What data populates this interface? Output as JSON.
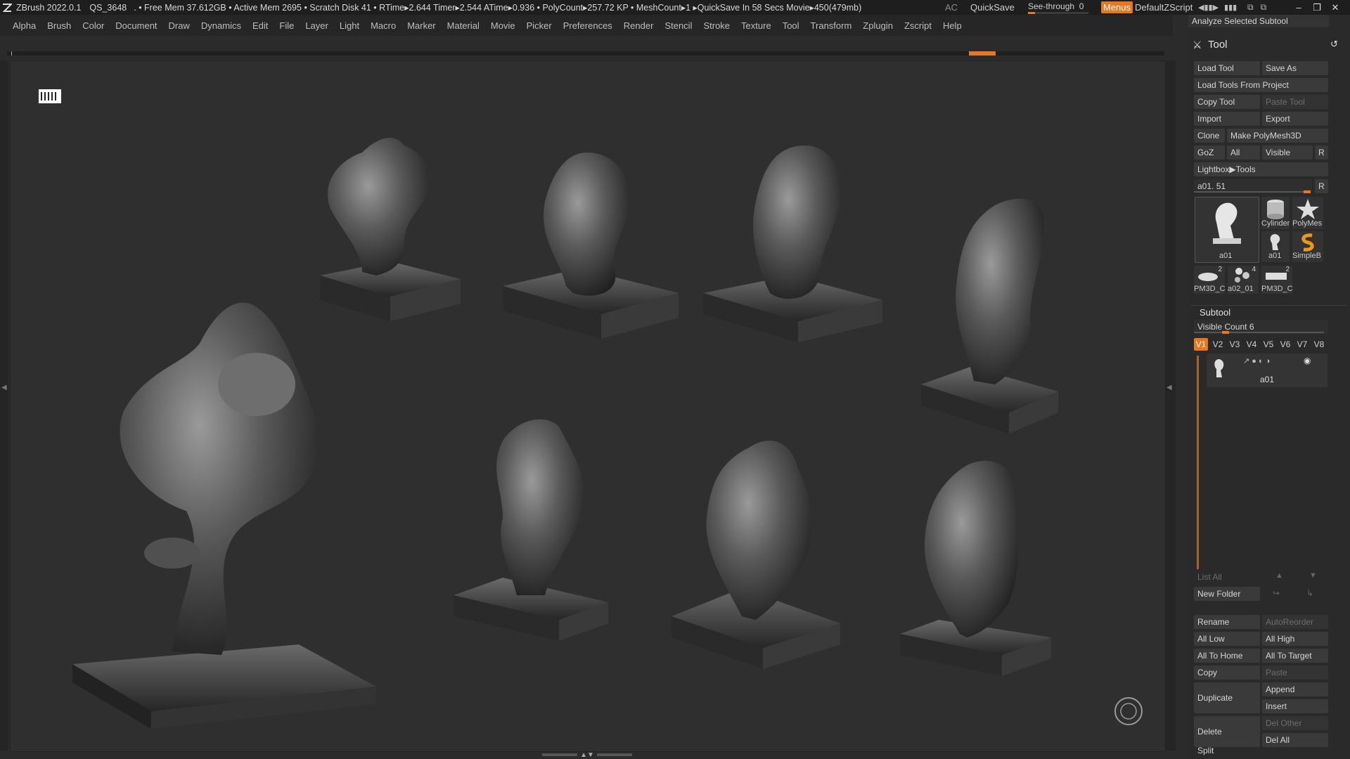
{
  "titlebar": {
    "app": "ZBrush 2022.0.1",
    "project": "QS_3648",
    "status": ". • Free Mem 37.612GB • Active Mem 2695 • Scratch Disk 41 • RTime▸2.644 Timer▸2.544 ATime▸0.936 • PolyCount▸257.72 KP • MeshCount▸1 ▸QuickSave In 58 Secs Movie▸450(479mb)",
    "ac": "AC",
    "quicksave": "QuickSave",
    "see_through_label": "See-through",
    "see_through_value": "0",
    "menus": "Menus",
    "default_zscript": "DefaultZScript"
  },
  "menubar": [
    "Alpha",
    "Brush",
    "Color",
    "Document",
    "Draw",
    "Dynamics",
    "Edit",
    "File",
    "Layer",
    "Light",
    "Macro",
    "Marker",
    "Material",
    "Movie",
    "Picker",
    "Preferences",
    "Render",
    "Stencil",
    "Stroke",
    "Texture",
    "Tool",
    "Transform",
    "Zplugin",
    "Zscript",
    "Help"
  ],
  "tool_panel": {
    "analyze": "Analyze Selected Subtool",
    "title": "Tool",
    "load_tool": "Load Tool",
    "save_as": "Save As",
    "load_tools_from_project": "Load Tools From Project",
    "copy_tool": "Copy Tool",
    "paste_tool": "Paste Tool",
    "import": "Import",
    "export": "Export",
    "clone": "Clone",
    "make_polymesh3d": "Make PolyMesh3D",
    "goz": "GoZ",
    "all": "All",
    "visible": "Visible",
    "r": "R",
    "lightbox_tools": "Lightbox▶Tools",
    "current_tool": "a01. 51",
    "thumbs": [
      {
        "label": "a01"
      },
      {
        "label": "Cylinder"
      },
      {
        "label": "PolyMes"
      },
      {
        "label": "a01"
      },
      {
        "label": "SimpleB"
      },
      {
        "label": "PM3D_C",
        "count": "2"
      },
      {
        "label": "a02_01",
        "count": "4"
      },
      {
        "label": "PM3D_C",
        "count": "2"
      }
    ]
  },
  "subtool": {
    "title": "Subtool",
    "visible_count": "Visible Count 6",
    "tabs": [
      "V1",
      "V2",
      "V3",
      "V4",
      "V5",
      "V6",
      "V7",
      "V8"
    ],
    "item_name": "a01",
    "list_all": "List All",
    "new_folder": "New Folder",
    "rename": "Rename",
    "autoreorder": "AutoReorder",
    "all_low": "All Low",
    "all_high": "All High",
    "all_to_home": "All To Home",
    "all_to_target": "All To Target",
    "copy": "Copy",
    "paste": "Paste",
    "duplicate": "Duplicate",
    "append": "Append",
    "insert": "Insert",
    "delete": "Delete",
    "del_other": "Del Other",
    "del_all": "Del All",
    "split": "Split"
  },
  "colors": {
    "accent": "#e8781f",
    "background": "#2b2b2b",
    "canvas": "#2f2f2f"
  }
}
